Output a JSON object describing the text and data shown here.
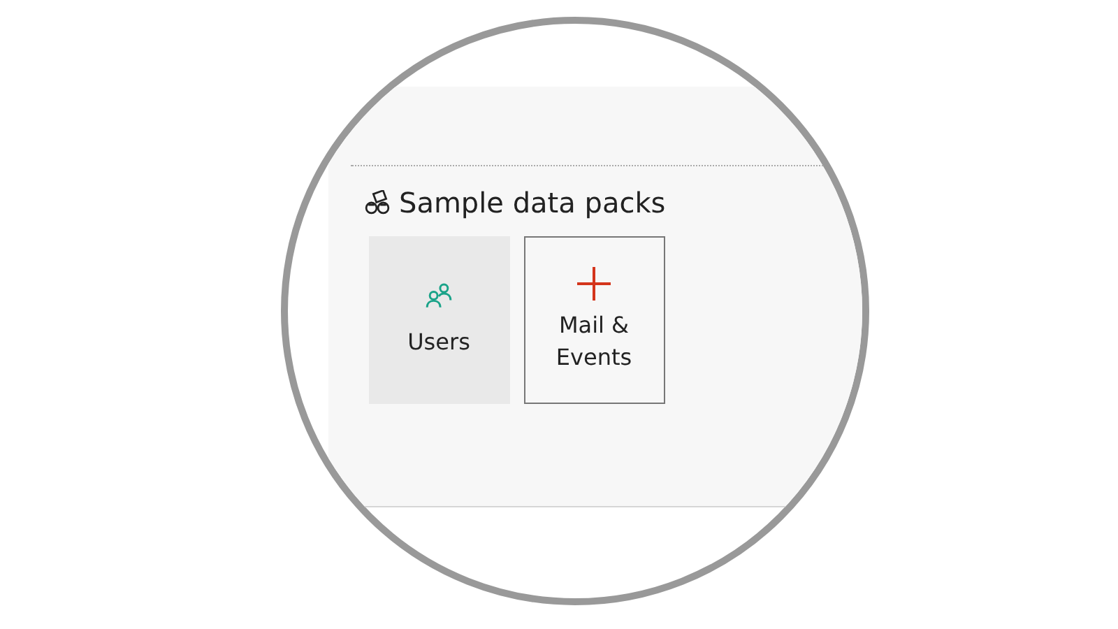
{
  "section": {
    "title": "Sample data packs"
  },
  "packs": [
    {
      "label": "Users",
      "kind": "users",
      "selected": true
    },
    {
      "label": "Mail &\nEvents",
      "kind": "add",
      "selected": false
    }
  ]
}
